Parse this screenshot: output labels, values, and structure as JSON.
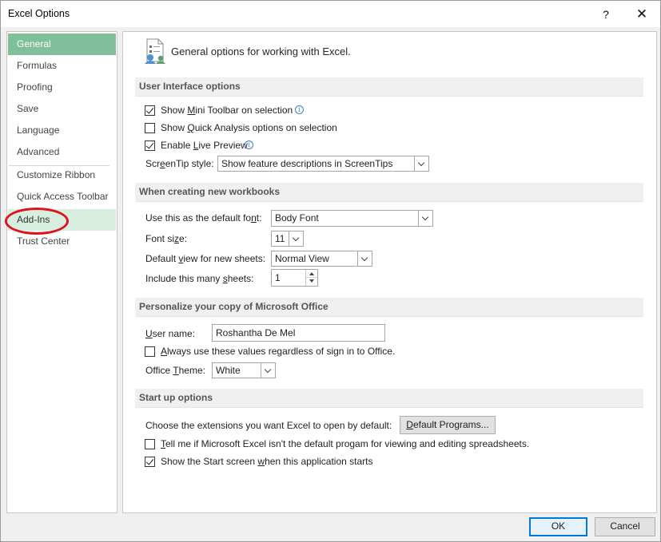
{
  "window": {
    "title": "Excel Options",
    "help_glyph": "?",
    "close_glyph": "✕"
  },
  "sidebar": {
    "items": [
      {
        "label": "General"
      },
      {
        "label": "Formulas"
      },
      {
        "label": "Proofing"
      },
      {
        "label": "Save"
      },
      {
        "label": "Language"
      },
      {
        "label": "Advanced"
      },
      {
        "label": "Customize Ribbon"
      },
      {
        "label": "Quick Access Toolbar"
      },
      {
        "label": "Add-Ins"
      },
      {
        "label": "Trust Center"
      }
    ],
    "selected": "General",
    "highlighted": "Add-Ins"
  },
  "header": {
    "text": "General options for working with Excel."
  },
  "ui_options": {
    "title": "User Interface options",
    "mini_toolbar": {
      "pre": "Show ",
      "key": "M",
      "post": "ini Toolbar on selection",
      "checked": true
    },
    "quick_analysis": {
      "pre": "Show ",
      "key": "Q",
      "post": "uick Analysis options on selection",
      "checked": false
    },
    "live_preview": {
      "pre": "Enable ",
      "key": "L",
      "post": "ive Preview",
      "checked": true
    },
    "screentip": {
      "label_pre": "Scr",
      "label_key": "e",
      "label_post": "enTip style:",
      "value": "Show feature descriptions in ScreenTips"
    }
  },
  "new_workbooks": {
    "title": "When creating new workbooks",
    "default_font": {
      "label_pre": "Use this as the default fo",
      "label_key": "n",
      "label_post": "t:",
      "value": "Body Font"
    },
    "font_size": {
      "label_pre": "Font si",
      "label_key": "z",
      "label_post": "e:",
      "value": "11"
    },
    "default_view": {
      "label_pre": "Default ",
      "label_key": "v",
      "label_post": "iew for new sheets:",
      "value": "Normal View"
    },
    "sheets": {
      "label_pre": "Include this many ",
      "label_key": "s",
      "label_post": "heets:",
      "value": "1"
    }
  },
  "personalize": {
    "title": "Personalize your copy of Microsoft Office",
    "user_name": {
      "label_key": "U",
      "label_post": "ser name:",
      "value": "Roshantha De Mel"
    },
    "always_use": {
      "key": "A",
      "post": "lways use these values regardless of sign in to Office.",
      "checked": false
    },
    "theme": {
      "label_pre": "Office ",
      "label_key": "T",
      "label_post": "heme:",
      "value": "White"
    }
  },
  "startup": {
    "title": "Start up options",
    "extensions_label": "Choose the extensions you want Excel to open by default:",
    "default_programs": {
      "key": "D",
      "post": "efault Programs..."
    },
    "tell_me": {
      "key": "T",
      "post": "ell me if Microsoft Excel isn't the default progam for viewing and editing spreadsheets.",
      "checked": false
    },
    "show_start": {
      "pre": "Show the Start screen ",
      "key": "w",
      "post": "hen this application starts",
      "checked": true
    }
  },
  "footer": {
    "ok": "OK",
    "cancel": "Cancel"
  },
  "colors": {
    "nav_selected": "#7fbf99",
    "nav_hover": "#d8eedf",
    "highlight_ellipse": "#e0121a",
    "default_button_border": "#0078d7"
  }
}
